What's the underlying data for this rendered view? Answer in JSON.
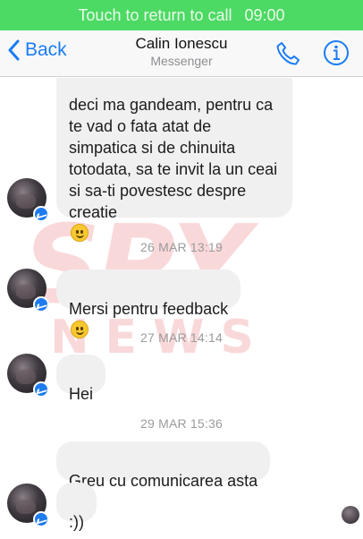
{
  "call_bar": {
    "text": "Touch to return to call",
    "time": "09:00"
  },
  "header": {
    "back_label": "Back",
    "title": "Calin Ionescu",
    "subtitle": "Messenger",
    "call_icon": "phone-icon",
    "info_icon": "info-icon"
  },
  "watermark": {
    "big": "SPY",
    "small": "NEWS"
  },
  "thread": {
    "messages": [
      {
        "text": "deci ma gandeam, pentru ca\nte vad o fata atat de\nsimpatica si de chinuita\ntotodata, sa te invit la un ceai\nsi sa-ti povestesc despre\ncreatie",
        "emoji": "smile-emoji"
      },
      {
        "stamp": "26 MAR 13:19"
      },
      {
        "text": "Mersi pentru feedback",
        "emoji": "grin-emoji"
      },
      {
        "stamp": "27 MAR 14:14"
      },
      {
        "text": "Hei"
      },
      {
        "stamp": "29 MAR 15:36"
      },
      {
        "text": "Greu cu comunicarea asta"
      },
      {
        "text": ":))"
      }
    ]
  },
  "colors": {
    "accent": "#1a7cf5",
    "call_bar": "#4cd964",
    "bubble": "#f0f0f1",
    "stamp": "#9b9b9b"
  }
}
